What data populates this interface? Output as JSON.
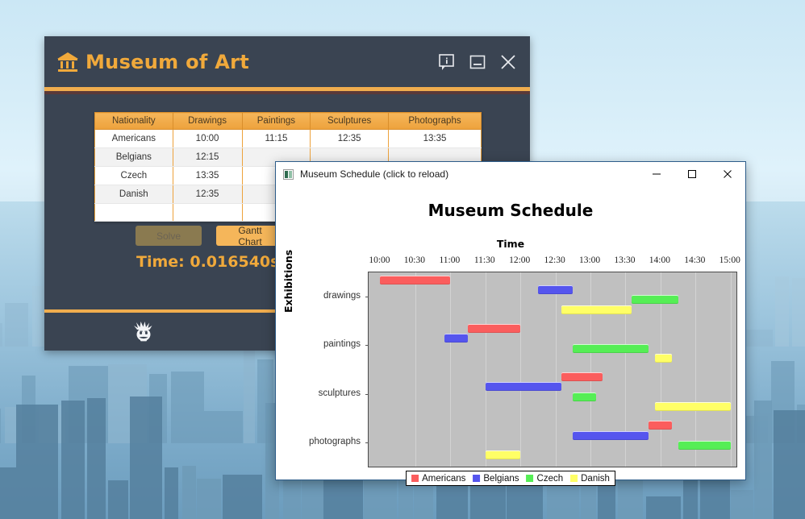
{
  "app_window": {
    "title": "Museum of Art",
    "icon": "museum-icon",
    "controls": [
      {
        "name": "info-icon",
        "glyph": "info"
      },
      {
        "name": "minimize-icon",
        "glyph": "minimize"
      },
      {
        "name": "close-icon",
        "glyph": "close"
      }
    ],
    "table": {
      "headers": [
        "Nationality",
        "Drawings",
        "Paintings",
        "Sculptures",
        "Photographs"
      ],
      "rows": [
        [
          "Americans",
          "10:00",
          "11:15",
          "12:35",
          "13:35"
        ],
        [
          "Belgians",
          "12:15",
          "",
          "",
          ""
        ],
        [
          "Czech",
          "13:35",
          "",
          "",
          ""
        ],
        [
          "Danish",
          "12:35",
          "",
          "",
          ""
        ],
        [
          "",
          "",
          "",
          "",
          ""
        ]
      ]
    },
    "solve_button": "Solve",
    "gantt_button": "Gantt Chart",
    "time_label": "Time: 0.016540s",
    "footer_icon": "einstein-face-icon"
  },
  "chart_window": {
    "window_title": "Museum Schedule (click to reload)",
    "window_icon": "chart-window-icon",
    "controls": [
      {
        "name": "minimize-button",
        "glyph": "minimize"
      },
      {
        "name": "maximize-button",
        "glyph": "maximize"
      },
      {
        "name": "close-button",
        "glyph": "close"
      }
    ]
  },
  "chart_data": {
    "type": "bar",
    "title": "Museum Schedule",
    "xlabel": "Time",
    "ylabel": "Exhibitions",
    "xtick_labels": [
      "10:00",
      "10:30",
      "11:00",
      "11:30",
      "12:00",
      "12:30",
      "13:00",
      "13:30",
      "14:00",
      "14:30",
      "15:00"
    ],
    "xlim": [
      "09:50",
      "15:05"
    ],
    "xlim_minutes": [
      590,
      905
    ],
    "categories": [
      "drawings",
      "paintings",
      "sculptures",
      "photographs"
    ],
    "legend": [
      {
        "name": "Americans",
        "color": "#fb5d5d"
      },
      {
        "name": "Belgians",
        "color": "#5555ee"
      },
      {
        "name": "Czech",
        "color": "#55ee55"
      },
      {
        "name": "Danish",
        "color": "#ffff66"
      }
    ],
    "legend_position": "bottom-center",
    "grid": true,
    "bars": [
      {
        "row": "drawings",
        "series": "Americans",
        "start": "10:00",
        "end": "11:00",
        "color": "#fb5d5d",
        "sublane": 0
      },
      {
        "row": "drawings",
        "series": "Belgians",
        "start": "12:15",
        "end": "12:45",
        "color": "#5555ee",
        "sublane": 1
      },
      {
        "row": "drawings",
        "series": "Czech",
        "start": "13:35",
        "end": "14:15",
        "color": "#55ee55",
        "sublane": 2
      },
      {
        "row": "drawings",
        "series": "Danish",
        "start": "12:35",
        "end": "13:35",
        "color": "#ffff66",
        "sublane": 3
      },
      {
        "row": "paintings",
        "series": "Americans",
        "start": "11:15",
        "end": "12:00",
        "color": "#fb5d5d",
        "sublane": 0
      },
      {
        "row": "paintings",
        "series": "Belgians",
        "start": "10:55",
        "end": "11:15",
        "color": "#5555ee",
        "sublane": 1
      },
      {
        "row": "paintings",
        "series": "Czech",
        "start": "12:45",
        "end": "13:50",
        "color": "#55ee55",
        "sublane": 2
      },
      {
        "row": "paintings",
        "series": "Danish",
        "start": "13:55",
        "end": "14:10",
        "color": "#ffff66",
        "sublane": 3
      },
      {
        "row": "sculptures",
        "series": "Americans",
        "start": "12:35",
        "end": "13:10",
        "color": "#fb5d5d",
        "sublane": 0
      },
      {
        "row": "sculptures",
        "series": "Belgians",
        "start": "11:30",
        "end": "12:35",
        "color": "#5555ee",
        "sublane": 1
      },
      {
        "row": "sculptures",
        "series": "Czech",
        "start": "12:45",
        "end": "13:05",
        "color": "#55ee55",
        "sublane": 2
      },
      {
        "row": "sculptures",
        "series": "Danish",
        "start": "13:55",
        "end": "15:00",
        "color": "#ffff66",
        "sublane": 3
      },
      {
        "row": "photographs",
        "series": "Americans",
        "start": "13:50",
        "end": "14:10",
        "color": "#fb5d5d",
        "sublane": 0
      },
      {
        "row": "photographs",
        "series": "Belgians",
        "start": "12:45",
        "end": "13:50",
        "color": "#5555ee",
        "sublane": 1
      },
      {
        "row": "photographs",
        "series": "Czech",
        "start": "14:15",
        "end": "15:00",
        "color": "#55ee55",
        "sublane": 2
      },
      {
        "row": "photographs",
        "series": "Danish",
        "start": "11:30",
        "end": "12:00",
        "color": "#ffff66",
        "sublane": 3
      }
    ]
  },
  "theme": {
    "accent": "#f0ad4e",
    "window_bg": "#3a4452",
    "plot_bg": "#c0c0c0"
  }
}
